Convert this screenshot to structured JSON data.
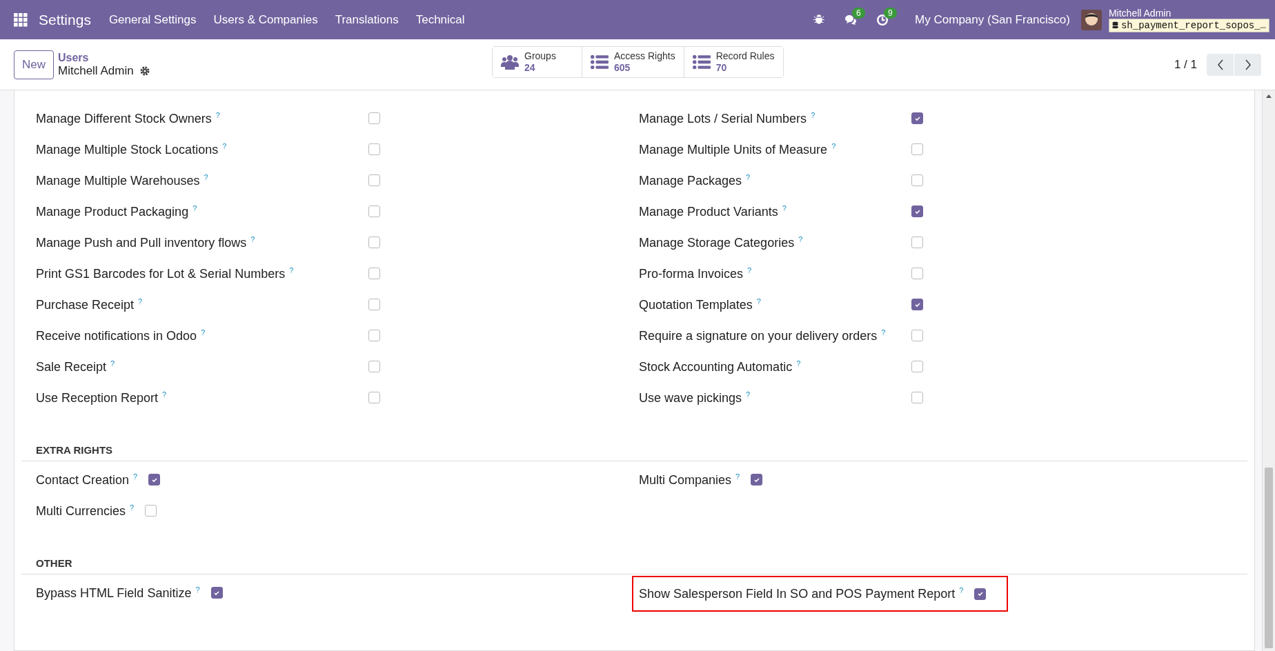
{
  "navbar": {
    "app": "Settings",
    "menus": [
      "General Settings",
      "Users & Companies",
      "Translations",
      "Technical"
    ],
    "chat_count": "6",
    "activity_count": "9",
    "company": "My Company (San Francisco)",
    "user": "Mitchell Admin",
    "database": "sh_payment_report_sopos_…"
  },
  "control_panel": {
    "new_button": "New",
    "breadcrumb": "Users",
    "record": "Mitchell Admin",
    "stats": [
      {
        "kind": "groups",
        "label": "Groups",
        "value": "24"
      },
      {
        "kind": "list",
        "label": "Access Rights",
        "value": "605"
      },
      {
        "kind": "list",
        "label": "Record Rules",
        "value": "70"
      }
    ],
    "pager": "1 / 1"
  },
  "sections": [
    {
      "kind": "grid",
      "items": [
        {
          "label": "Manage Different Stock Owners",
          "help": "?",
          "checked": false,
          "highlighted": false
        },
        {
          "label": "Manage Lots / Serial Numbers",
          "help": "?",
          "checked": true,
          "highlighted": false
        },
        {
          "label": "Manage Multiple Stock Locations",
          "help": "?",
          "checked": false,
          "highlighted": false
        },
        {
          "label": "Manage Multiple Units of Measure",
          "help": "?",
          "checked": false,
          "highlighted": false
        },
        {
          "label": "Manage Multiple Warehouses",
          "help": "?",
          "checked": false,
          "highlighted": false
        },
        {
          "label": "Manage Packages",
          "help": "?",
          "checked": false,
          "highlighted": false
        },
        {
          "label": "Manage Product Packaging",
          "help": "?",
          "checked": false,
          "highlighted": false
        },
        {
          "label": "Manage Product Variants",
          "help": "?",
          "checked": true,
          "highlighted": false
        },
        {
          "label": "Manage Push and Pull inventory flows",
          "help": "?",
          "checked": false,
          "highlighted": false
        },
        {
          "label": "Manage Storage Categories",
          "help": "?",
          "checked": false,
          "highlighted": false
        },
        {
          "label": "Print GS1 Barcodes for Lot & Serial Numbers",
          "help": "?",
          "checked": false,
          "highlighted": false
        },
        {
          "label": "Pro-forma Invoices",
          "help": "?",
          "checked": false,
          "highlighted": false
        },
        {
          "label": "Purchase Receipt",
          "help": "?",
          "checked": false,
          "highlighted": false
        },
        {
          "label": "Quotation Templates",
          "help": "?",
          "checked": true,
          "highlighted": false
        },
        {
          "label": "Receive notifications in Odoo",
          "help": "?",
          "checked": false,
          "highlighted": false
        },
        {
          "label": "Require a signature on your delivery orders",
          "help": "?",
          "checked": false,
          "highlighted": false
        },
        {
          "label": "Sale Receipt",
          "help": "?",
          "checked": false,
          "highlighted": false
        },
        {
          "label": "Stock Accounting Automatic",
          "help": "?",
          "checked": false,
          "highlighted": false
        },
        {
          "label": "Use Reception Report",
          "help": "?",
          "checked": false,
          "highlighted": false
        },
        {
          "label": "Use wave pickings",
          "help": "?",
          "checked": false,
          "highlighted": false
        }
      ]
    },
    {
      "kind": "inline",
      "title": "EXTRA RIGHTS",
      "items": [
        {
          "label": "Contact Creation",
          "help": "?",
          "checked": true,
          "highlighted": false
        },
        {
          "label": "Multi Companies",
          "help": "?",
          "checked": true,
          "highlighted": false
        },
        {
          "label": "Multi Currencies",
          "help": "?",
          "checked": false,
          "highlighted": false
        }
      ]
    },
    {
      "kind": "inline",
      "title": "OTHER",
      "items": [
        {
          "label": "Bypass HTML Field Sanitize",
          "help": "?",
          "checked": true,
          "highlighted": false
        },
        {
          "label": "Show Salesperson Field In SO and POS Payment Report",
          "help": "?",
          "checked": true,
          "highlighted": true
        }
      ]
    }
  ]
}
